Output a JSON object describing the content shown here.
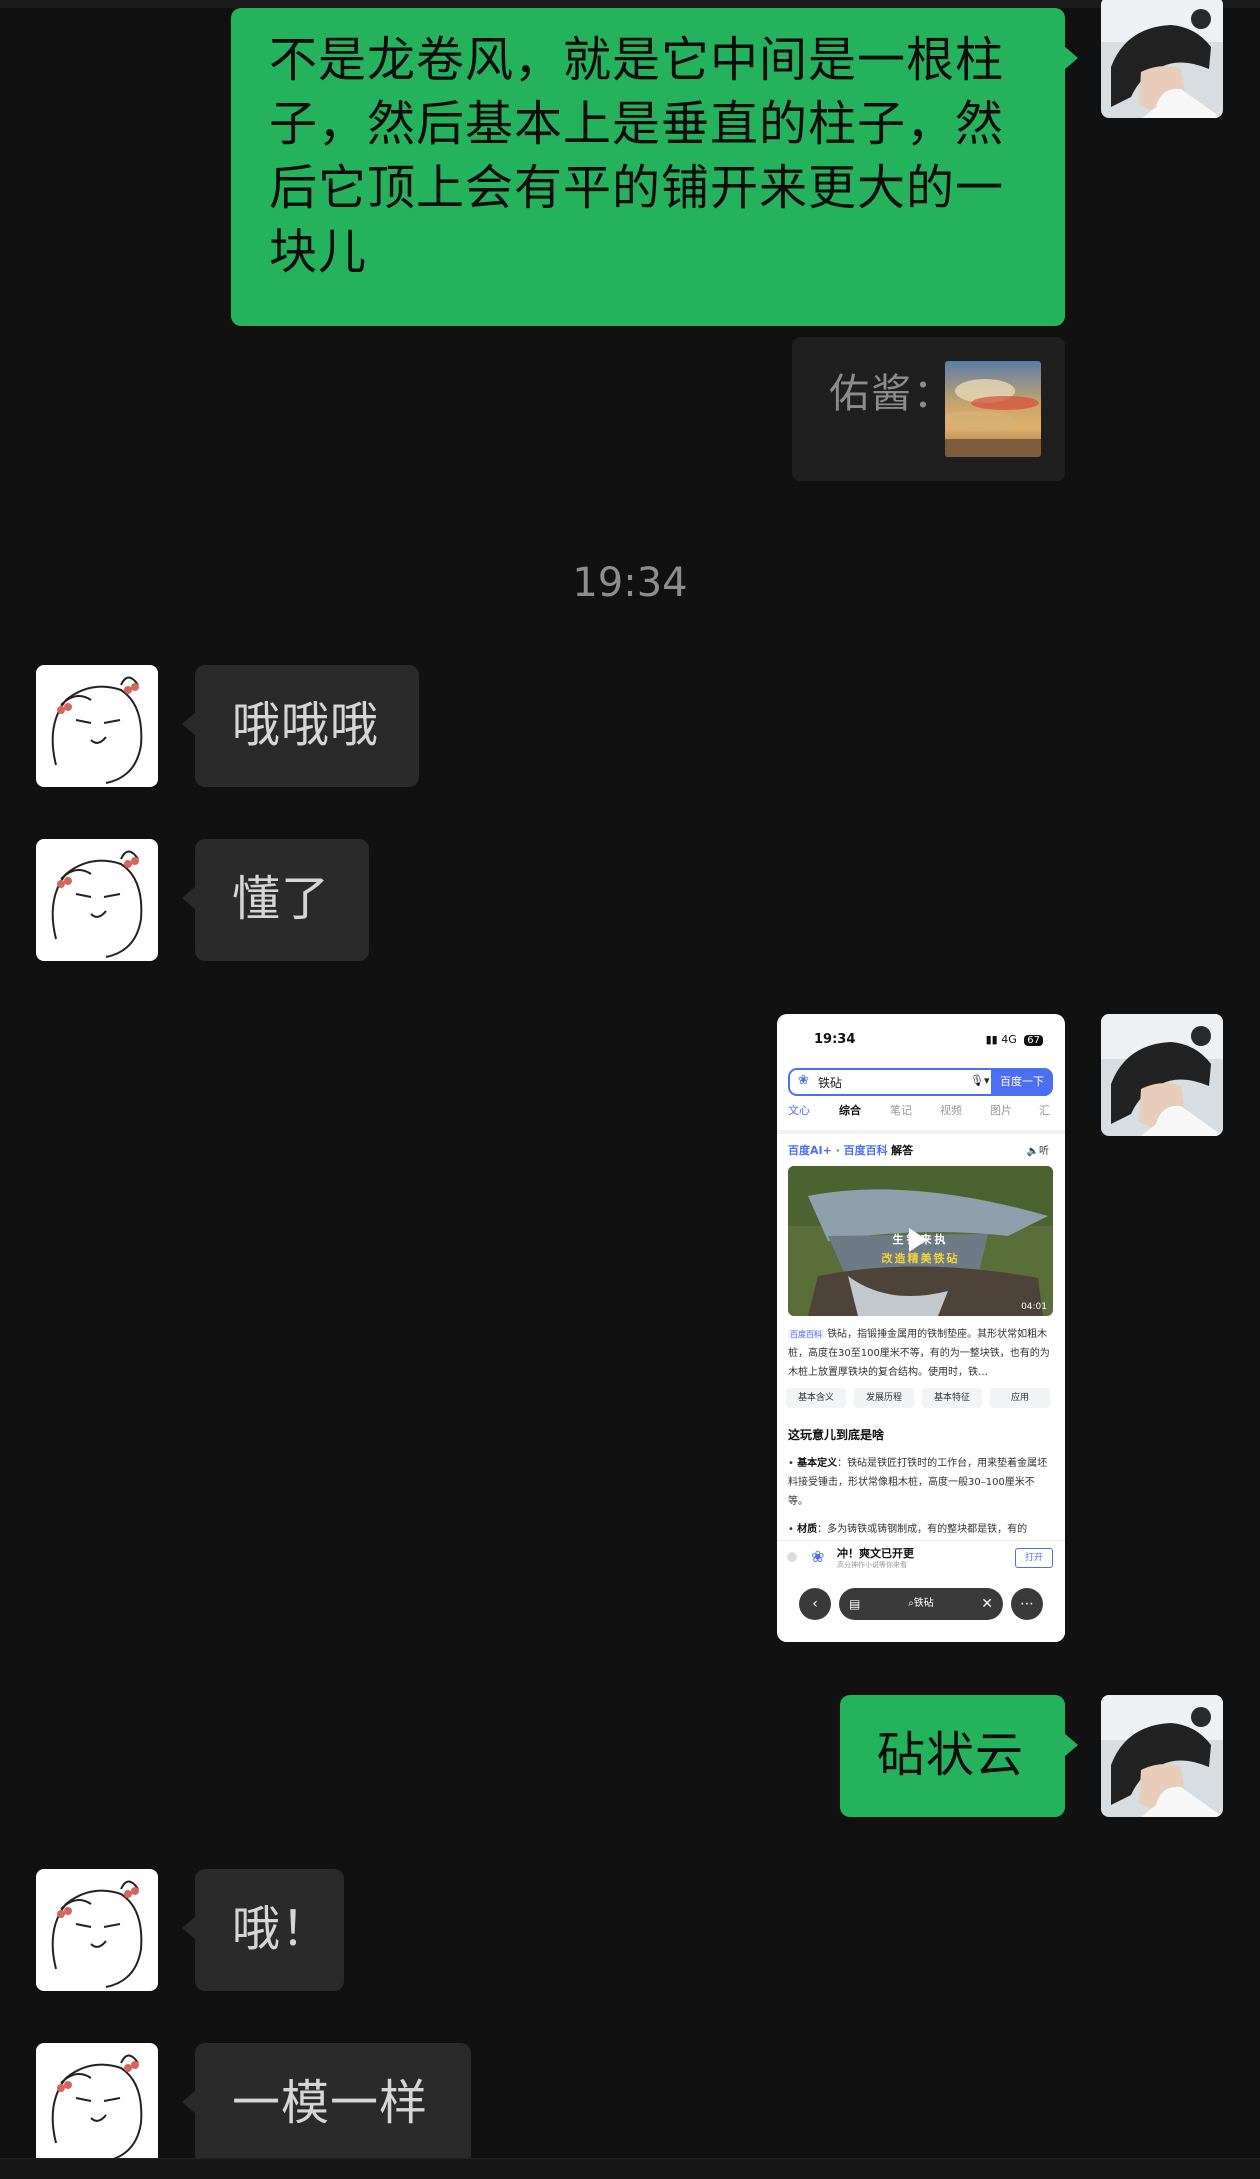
{
  "messages": {
    "m1": {
      "text": "不是龙卷风，就是它中间是一根柱子，然后基本上是垂直的柱子，然后它顶上会有平的铺开来更大的一块儿"
    },
    "quote": {
      "name": "佑酱："
    },
    "timestamp": "19:34",
    "m2": {
      "text": "哦哦哦"
    },
    "m3": {
      "text": "懂了"
    },
    "m5": {
      "text": "砧状云"
    },
    "m6": {
      "text": "哦！"
    },
    "m7": {
      "text": "一模一样"
    }
  },
  "screenshot": {
    "status_time": "19:34",
    "status_net": "4G",
    "status_battery": "67",
    "search_query": "铁砧",
    "search_button": "百度一下",
    "tabs": [
      "文心",
      "综合",
      "笔记",
      "视频",
      "图片",
      "汇"
    ],
    "ai_prefix": "百度AI+ · 百度百科",
    "ai_suffix": "解答",
    "listen": "听",
    "video_title_1": "生铁来执",
    "video_title_2": "改造精美铁砧",
    "video_duration": "04:01",
    "para_tag": "百度百科",
    "para_text": "铁砧，指锻捶金属用的铁制垫座。其形状常如粗木桩，高度在30至100厘米不等，有的为一整块铁，也有的为木桩上放置厚铁块的复合结构。使用时，铁…",
    "chips": [
      "基本含义",
      "发展历程",
      "基本特征",
      "应用"
    ],
    "section_title": "这玩意儿到底是啥",
    "li1_label": "基本定义",
    "li1_text": "：铁砧是铁匠打铁时的工作台，用来垫着金属坯料接受锤击，形状常像粗木桩，高度一般30–100厘米不等。",
    "li2_label": "材质",
    "li2_text": "：多为铸铁或铸钢制成，有的整块都是铁，有的",
    "banner_title": "冲！爽文已开更",
    "banner_sub": "高分神作小说等你来看",
    "banner_open": "打开",
    "pill_query": "铁砧"
  },
  "colors": {
    "background": "#111111",
    "outgoing_bubble": "#25b25c",
    "incoming_bubble": "#2a2a2a",
    "baidu_blue": "#4e6ef2"
  }
}
